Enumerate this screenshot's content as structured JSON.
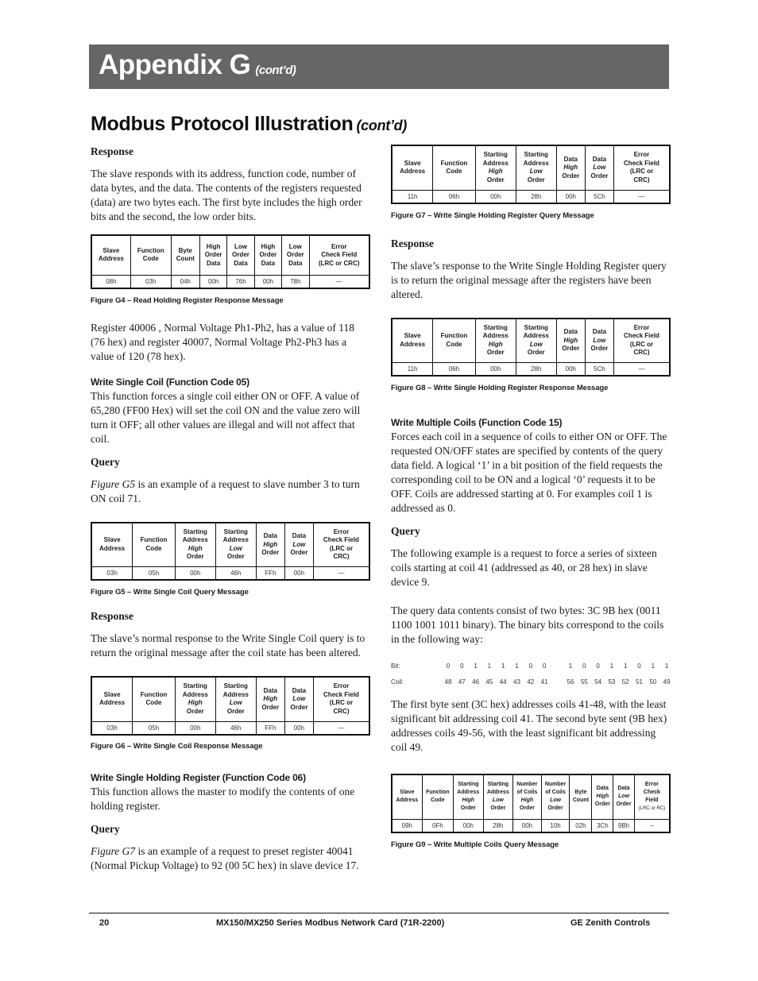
{
  "header": {
    "title": "Appendix G",
    "contd": "(cont’d)"
  },
  "section": {
    "title": "Modbus Protocol Illustration",
    "contd": "(cont’d)"
  },
  "left": {
    "response_heading": "Response",
    "response_text": "The slave responds with its address, function code, number of data bytes, and the data. The contents of the registers requested (data) are two bytes each. The first byte includes the high order bits and the second, the low order bits.",
    "fig_g4": {
      "headers": [
        [
          "Slave",
          "Address"
        ],
        [
          "Function",
          "Code"
        ],
        [
          "Byte",
          "Count"
        ],
        [
          "High",
          "Order",
          "Data"
        ],
        [
          "Low",
          "Order",
          "Data"
        ],
        [
          "High",
          "Order",
          "Data"
        ],
        [
          "Low",
          "Order",
          "Data"
        ],
        [
          "Error",
          "Check Field",
          "(LRC or CRC)"
        ]
      ],
      "values": [
        "08h",
        "03h",
        "04h",
        "00h",
        "76h",
        "00h",
        "78h",
        "—"
      ],
      "caption": "Figure G4 – Read Holding Register Response Message"
    },
    "register_text": "Register 40006 , Normal Voltage Ph1-Ph2, has a value of 118 (76 hex) and register 40007, Normal Voltage Ph2-Ph3 has a value of 120 (78 hex).",
    "wsc_heading": "Write Single Coil (Function Code 05)",
    "wsc_text": "This function forces a single coil either ON or OFF. A value of 65,280 (FF00 Hex) will set the coil ON and the value zero will turn it OFF; all other values are illegal and will not affect that coil.",
    "query_heading": "Query",
    "query_fig_ref": "Figure G5",
    "query_text": " is an example of a request to slave number 3 to turn ON coil 71.",
    "fig_g5": {
      "values": [
        "03h",
        "05h",
        "00h",
        "46h",
        "FFh",
        "00h",
        "—"
      ],
      "caption": "Figure G5 – Write Single Coil Query Message"
    },
    "response2_heading": "Response",
    "response2_text": "The slave’s normal response to the Write Single Coil query is to return the original message after the coil state has been altered.",
    "fig_g6": {
      "values": [
        "03h",
        "05h",
        "00h",
        "46h",
        "FFh",
        "00h",
        "—"
      ],
      "caption": "Figure G6 – Write Single Coil Response Message"
    },
    "wshr_heading": "Write Single Holding Register (Function Code 06)",
    "wshr_text": "This function allows the master to modify the contents of one holding register.",
    "query2_heading": "Query",
    "query2_fig_ref": "Figure G7",
    "query2_text": " is an example of a request to preset register 40041 (Normal Pickup Voltage) to 92 (00 5C hex) in slave device 17."
  },
  "single_headers": {
    "slave": [
      "Slave",
      "Address"
    ],
    "function": [
      "Function",
      "Code"
    ],
    "sa_high": [
      "Starting",
      "Address",
      "High",
      "Order"
    ],
    "sa_low": [
      "Starting",
      "Address",
      "Low",
      "Order"
    ],
    "data_high": [
      "Data",
      "High",
      "Order"
    ],
    "data_low": [
      "Data",
      "Low",
      "Order"
    ],
    "error": [
      "Error",
      "Check Field",
      "(LRC or",
      "CRC)"
    ]
  },
  "right": {
    "fig_g7": {
      "values": [
        "11h",
        "06h",
        "00h",
        "28h",
        "00h",
        "5Ch",
        "—"
      ],
      "caption": "Figure G7 – Write Single Holding Register Query Message"
    },
    "response_heading": "Response",
    "response_text": "The slave’s response to the Write Single Holding Register query is to return the original message after the registers have been altered.",
    "fig_g8": {
      "values": [
        "11h",
        "06h",
        "00h",
        "28h",
        "00h",
        "5Ch",
        "—"
      ],
      "caption": "Figure G8 – Write Single Holding Register Response Message"
    },
    "wmc_heading": "Write Multiple Coils (Function Code 15)",
    "wmc_text": "Forces each coil in a sequence of coils to either ON or OFF. The requested ON/OFF states are specified by contents of the query data field. A logical ‘1’ in a bit position of the field requests the corresponding coil to be ON and a logical ‘0’ requests it to be OFF. Coils are addressed starting at 0. For examples coil 1 is addressed as 0.",
    "query_heading": "Query",
    "query_text": "The following example is a request to force a series of sixteen coils starting at coil 41 (addressed as 40, or 28 hex) in slave device 9.",
    "data_text": "The query data contents consist of two bytes: 3C 9B hex (0011 1100 1001 1011 binary). The binary bits correspond to the coils in the following way:",
    "bit_table": {
      "bit_label": "Bit:",
      "coil_label": "Coil:",
      "bits": [
        "0",
        "0",
        "1",
        "1",
        "1",
        "1",
        "0",
        "0",
        "1",
        "0",
        "0",
        "1",
        "1",
        "0",
        "1",
        "1"
      ],
      "coils": [
        "48",
        "47",
        "46",
        "45",
        "44",
        "43",
        "42",
        "41",
        "56",
        "55",
        "54",
        "53",
        "52",
        "51",
        "50",
        "49"
      ]
    },
    "bytes_text": "The first byte sent (3C hex) addresses coils 41-48, with the least significant bit addressing coil 41. The second byte sent (9B hex) addresses coils 49-56, with the least significant bit addressing coil 49.",
    "fig_g9": {
      "headers": [
        [
          "Slave",
          "Address"
        ],
        [
          "Function",
          "Code"
        ],
        [
          "Starting",
          "Address",
          "High",
          "Order"
        ],
        [
          "Starting",
          "Address",
          "Low",
          "Order"
        ],
        [
          "Number",
          "of Coils",
          "High",
          "Order"
        ],
        [
          "Number",
          "of Coils",
          "Low",
          "Order"
        ],
        [
          "Byte",
          "Count"
        ],
        [
          "Data",
          "High",
          "Order"
        ],
        [
          "Data",
          "Low",
          "Order"
        ],
        [
          "Error",
          "Check",
          "Field",
          "(LRC or RC)"
        ]
      ],
      "values": [
        "09h",
        "0Fh",
        "00h",
        "28h",
        "00h",
        "10h",
        "02h",
        "3Ch",
        "9Bh",
        "–"
      ],
      "caption": "Figure G9 – Write Multiple Coils Query Message"
    }
  },
  "footer": {
    "page": "20",
    "doc_title": "MX150/MX250 Series Modbus Network Card (71R-2200)",
    "company": "GE Zenith Controls"
  }
}
